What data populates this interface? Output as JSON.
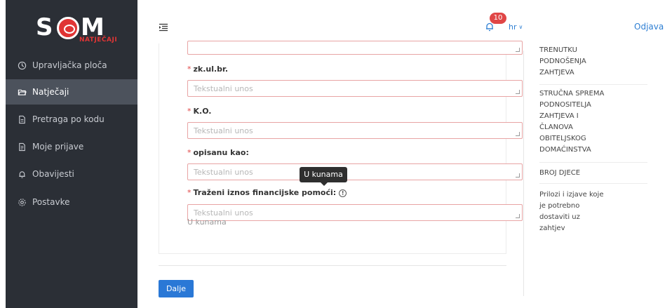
{
  "brand": {
    "logo_letters": "S O M",
    "logo_sub": "NATJEČAJI"
  },
  "sidebar": {
    "items": [
      {
        "label": "Upravljačka ploča",
        "icon": "dashboard-icon"
      },
      {
        "label": "Natječaji",
        "icon": "folder-open-icon",
        "active": true
      },
      {
        "label": "Pretraga po kodu",
        "icon": "document-icon"
      },
      {
        "label": "Moje prijave",
        "icon": "file-list-icon"
      },
      {
        "label": "Obavijesti",
        "icon": "bell-icon"
      },
      {
        "label": "Postavke",
        "icon": "gear-icon"
      }
    ]
  },
  "header": {
    "notifications_count": "10",
    "language": "hr",
    "logout": "Odjava"
  },
  "form": {
    "fields": [
      {
        "label": "",
        "placeholder": "..."
      },
      {
        "label": "zk.ul.br.",
        "placeholder": "Tekstualni unos"
      },
      {
        "label": "K.O.",
        "placeholder": "Tekstualni unos"
      },
      {
        "label": "opisanu kao:",
        "placeholder": "Tekstualni unos"
      },
      {
        "label": "Traženi iznos financijske pomoći:",
        "placeholder": "Tekstualni unos"
      }
    ],
    "required_mark": "*",
    "help_text": "U kunama",
    "tooltip": "U kunama",
    "next_button": "Dalje"
  },
  "right_panel": {
    "items": [
      "TRENUTKU\nPODNOŠENJA\nZAHTJEVA",
      "STRUČNA SPREMA\nPODNOSITELJA\nZAHTJEVA I\nČLANOVA\nOBITELJSKOG\nDOMAĆINSTVA",
      "BROJ DJECE",
      "Prilozi i izjave koje\nje potrebno\ndostaviti uz\nzahtjev"
    ]
  },
  "colors": {
    "sidebar_bg": "#2b2f36",
    "sidebar_active": "#4c525c",
    "accent": "#2a78d6",
    "required": "#e04646",
    "badge": "#e04646"
  }
}
